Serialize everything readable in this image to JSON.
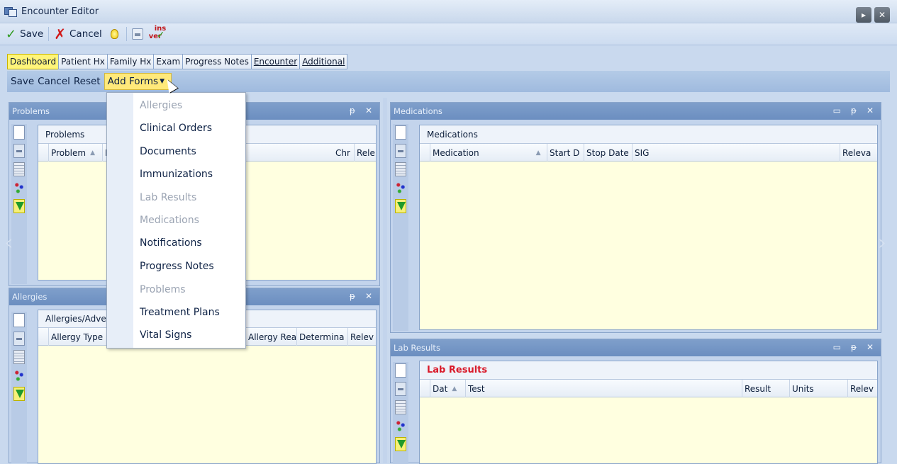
{
  "window": {
    "title": "Encounter Editor"
  },
  "toolbar": {
    "save": "Save",
    "cancel": "Cancel",
    "ins": "ins",
    "ver": "ver"
  },
  "tabs": [
    "Dashboard",
    "Patient Hx",
    "Family Hx",
    "Exam",
    "Progress Notes",
    "Encounter",
    "Additional"
  ],
  "subbar": {
    "save": "Save",
    "cancel": "Cancel",
    "reset": "Reset",
    "add_forms": "Add Forms"
  },
  "add_forms_menu": [
    {
      "label": "Allergies",
      "enabled": false
    },
    {
      "label": "Clinical Orders",
      "enabled": true
    },
    {
      "label": "Documents",
      "enabled": true
    },
    {
      "label": "Immunizations",
      "enabled": true
    },
    {
      "label": "Lab Results",
      "enabled": false
    },
    {
      "label": "Medications",
      "enabled": false
    },
    {
      "label": "Notifications",
      "enabled": true
    },
    {
      "label": "Progress Notes",
      "enabled": true
    },
    {
      "label": "Problems",
      "enabled": false
    },
    {
      "label": "Treatment Plans",
      "enabled": true
    },
    {
      "label": "Vital Signs",
      "enabled": true
    }
  ],
  "problems": {
    "panel_title": "Problems",
    "caption": "Problems",
    "columns": [
      "Problem",
      "D",
      "Chr",
      "Rele"
    ]
  },
  "allergies": {
    "panel_title": "Allergies",
    "caption": "Allergies/Adve",
    "columns": [
      "Allergy Type",
      "Allergy Rea",
      "Determina",
      "Relev"
    ]
  },
  "medications": {
    "panel_title": "Medications",
    "caption": "Medications",
    "columns": [
      "Medication",
      "Start D",
      "Stop Date",
      "SIG",
      "Releva"
    ]
  },
  "lab_results": {
    "panel_title": "Lab Results",
    "caption": "Lab Results",
    "columns": [
      "Dat",
      "Test",
      "Result",
      "Units",
      "Relev"
    ]
  },
  "panel_controls": {
    "pin": "ᵽ",
    "close": "✕",
    "maximize": "▭"
  }
}
